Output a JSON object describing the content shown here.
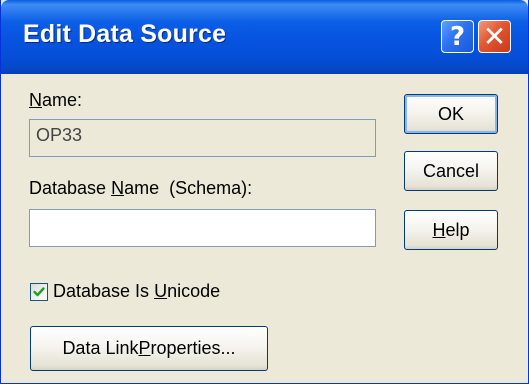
{
  "window": {
    "title": "Edit Data Source",
    "help_glyph": "?",
    "close_glyph": "✕"
  },
  "name_label": {
    "accel": "N",
    "rest": "ame:"
  },
  "name_value": "OP33",
  "schema_label": {
    "pre": "Database ",
    "accel": "N",
    "rest": "ame  (Schema):"
  },
  "schema_value": "",
  "unicode_checkbox": {
    "pre": "Database Is ",
    "accel": "U",
    "rest": "nicode",
    "checked": true
  },
  "buttons": {
    "ok": "OK",
    "cancel": "Cancel",
    "help": {
      "accel": "H",
      "rest": "elp"
    },
    "data_link": {
      "pre": "Data Link ",
      "accel": "P",
      "rest": "roperties..."
    }
  },
  "colors": {
    "titlebar": "#0653e0",
    "dialog_bg": "#ece9d8",
    "check": "#21a121"
  }
}
